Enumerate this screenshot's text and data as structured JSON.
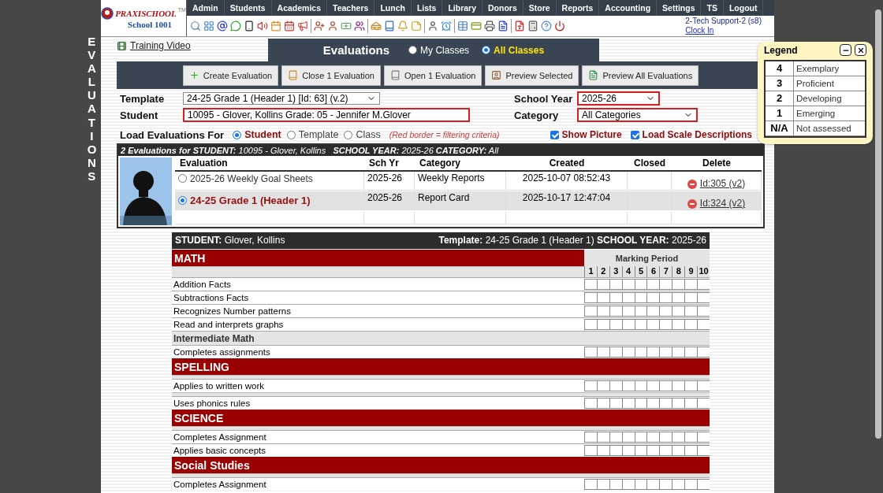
{
  "side_title": "EVALUATIONS",
  "logo": {
    "brand": "PRAXISCHOOL",
    "tm": "TM",
    "school": "School 1001"
  },
  "menu": [
    {
      "label": "Admin"
    },
    {
      "label": "Students"
    },
    {
      "label": "Academics"
    },
    {
      "label": "Teachers"
    },
    {
      "label": "Lunch"
    },
    {
      "label": "Lists"
    },
    {
      "label": "Library"
    },
    {
      "label": "Donors"
    },
    {
      "label": "Store"
    },
    {
      "label": "Reports"
    },
    {
      "label": "Accounting"
    },
    {
      "label": "Settings"
    },
    {
      "label": "TS"
    },
    {
      "label": "Logout"
    }
  ],
  "user": {
    "name": "2-Tech Support-2 (s8)",
    "link": "Clock In"
  },
  "training_link": "Training Video",
  "title": "Evaluations",
  "scope": [
    {
      "label": "My Classes",
      "selected": false
    },
    {
      "label": "All Classes",
      "selected": true
    }
  ],
  "actions": [
    {
      "label": "Create Evaluation"
    },
    {
      "label": "Close 1 Evaluation"
    },
    {
      "label": "Open 1 Evaluation"
    },
    {
      "label": "Preview Selected"
    },
    {
      "label": "Preview All Evaluations"
    }
  ],
  "form": {
    "template_label": "Template",
    "template": "24-25 Grade 1 (Header 1) [Id: 63] (v.2)",
    "student_label": "Student",
    "student": "10095 - Glover, Kollins Grade: 05 - Jennifer M.Glover",
    "year_label": "School Year",
    "year": "2025-26",
    "category_label": "Category",
    "category": "All Categories"
  },
  "load_for": {
    "label": "Load Evaluations For",
    "options": [
      {
        "label": "Student",
        "selected": true
      },
      {
        "label": "Template",
        "selected": false
      },
      {
        "label": "Class",
        "selected": false
      }
    ],
    "note": "(Red border = filtering criteria)"
  },
  "options": [
    {
      "label": "Show Picture",
      "checked": true
    },
    {
      "label": "Load Scale Descriptions",
      "checked": true
    }
  ],
  "list": {
    "summary": "**2 Evaluations for STUDENT:** 10095 - Glover, Kollins   **SCHOOL YEAR:** 2025-26 **CATEGORY:** All",
    "columns": [
      "Evaluation",
      "Sch Yr",
      "Category",
      "Created",
      "Closed",
      "Delete"
    ],
    "rows": [
      {
        "evaluation": "2025-26 Weekly Goal Sheets",
        "year": "2025-26",
        "category": "Weekly Reports",
        "created": "2025-10-07 08:52:43",
        "delete": "Id:305 (v2)",
        "selected": false
      },
      {
        "evaluation": "24-25 Grade 1 (Header 1)",
        "year": "2025-26",
        "category": "Report Card",
        "created": "2025-10-17 12:47:04",
        "delete": "Id:324 (v2)",
        "selected": true
      }
    ]
  },
  "report": {
    "student": "**STUDENT:** Glover, Kollins",
    "template": "**Template:** 24-25 Grade 1 (Header 1) **SCHOOL YEAR:** 2025-26",
    "header_category": "MATH",
    "marking_label": "Marking Period",
    "periods": [
      "1",
      "2",
      "3",
      "4",
      "5",
      "6",
      "7",
      "8",
      "9",
      "10"
    ],
    "rows": [
      {
        "kind": "item",
        "label": "Addition Facts"
      },
      {
        "kind": "item",
        "label": "Subtractions Facts"
      },
      {
        "kind": "item",
        "label": "Recognizes Number patterns"
      },
      {
        "kind": "item",
        "label": "Read and interprets graphs"
      },
      {
        "kind": "subcategory",
        "label": "Intermediate Math"
      },
      {
        "kind": "item",
        "label": "Completes assignments"
      },
      {
        "kind": "category",
        "label": "SPELLING"
      },
      {
        "kind": "spacer"
      },
      {
        "kind": "item",
        "label": "Applies to written work"
      },
      {
        "kind": "spacer"
      },
      {
        "kind": "item",
        "label": "Uses phonics rules"
      },
      {
        "kind": "category",
        "label": "SCIENCE"
      },
      {
        "kind": "spacer"
      },
      {
        "kind": "item",
        "label": "Completes Assignment"
      },
      {
        "kind": "item",
        "label": "Applies basic concepts"
      },
      {
        "kind": "category",
        "label": "Social Studies"
      },
      {
        "kind": "spacer"
      },
      {
        "kind": "item",
        "label": "Completes Assignment"
      }
    ]
  },
  "legend": {
    "title": "Legend",
    "rows": [
      {
        "score": "4",
        "label": "Exemplary"
      },
      {
        "score": "3",
        "label": "Proficient"
      },
      {
        "score": "2",
        "label": "Developing"
      },
      {
        "score": "1",
        "label": "Emerging"
      },
      {
        "score": "N/A",
        "label": "Not assessed"
      }
    ]
  }
}
